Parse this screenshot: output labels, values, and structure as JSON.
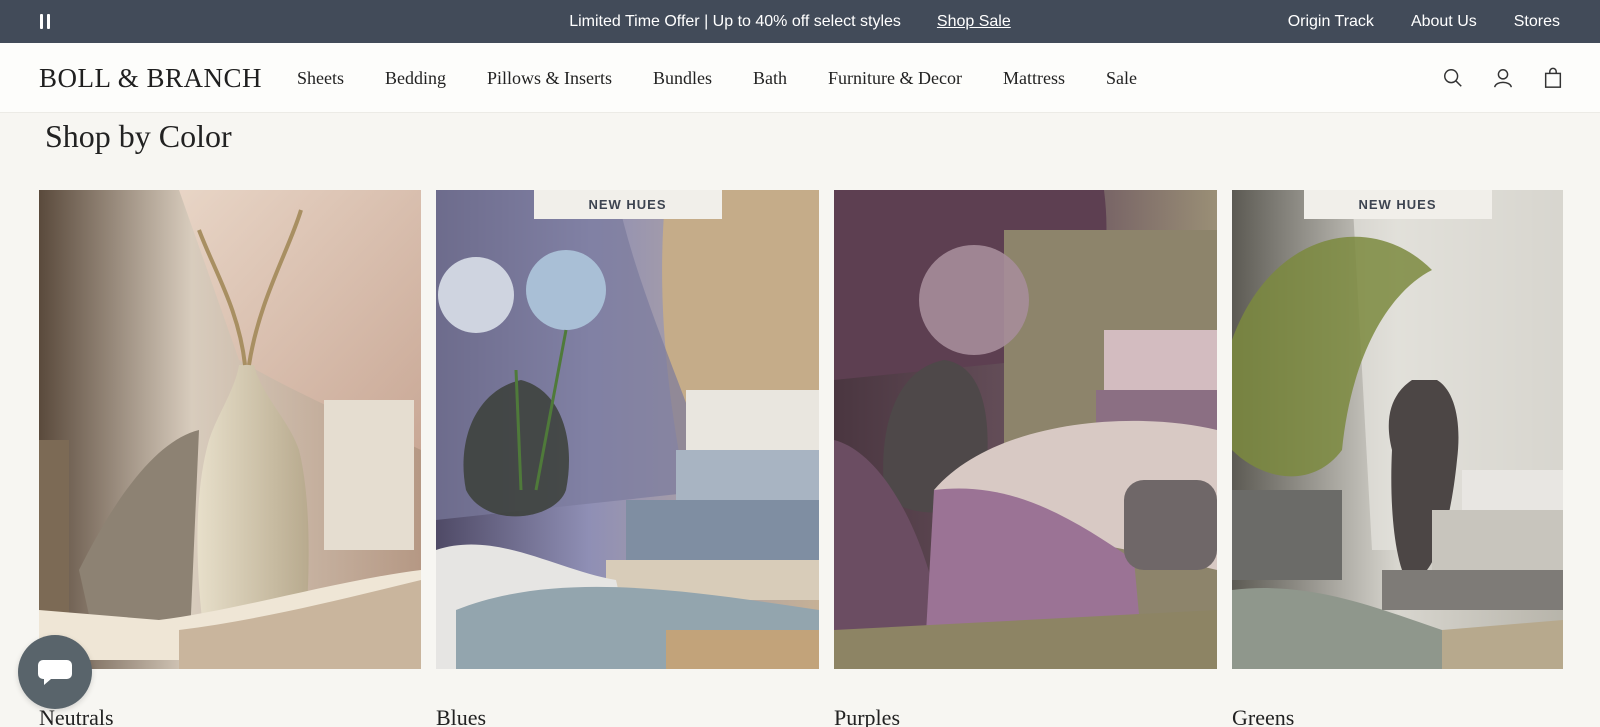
{
  "promo": {
    "message": "Limited Time Offer | Up to 40% off select styles",
    "link_label": "Shop Sale",
    "pause_icon": "pause-icon"
  },
  "utility_nav": [
    "Origin Track",
    "About Us",
    "Stores"
  ],
  "header": {
    "logo": "BOLL & BRANCH",
    "nav": [
      "Sheets",
      "Bedding",
      "Pillows & Inserts",
      "Bundles",
      "Bath",
      "Furniture & Decor",
      "Mattress",
      "Sale"
    ],
    "icons": [
      "search-icon",
      "account-icon",
      "bag-icon"
    ]
  },
  "section": {
    "title": "Shop by Color",
    "cards": [
      {
        "label": "Neutrals",
        "badge": ""
      },
      {
        "label": "Blues",
        "badge": "NEW HUES"
      },
      {
        "label": "Purples",
        "badge": ""
      },
      {
        "label": "Greens",
        "badge": "NEW HUES"
      }
    ]
  },
  "chat": {
    "icon": "chat-icon"
  },
  "colors": {
    "promo_bar": "#424b59",
    "background": "#f7f6f2",
    "header_bg": "#fdfdfb",
    "chat_button": "#59646b",
    "badge_bg": "#f1efea"
  }
}
